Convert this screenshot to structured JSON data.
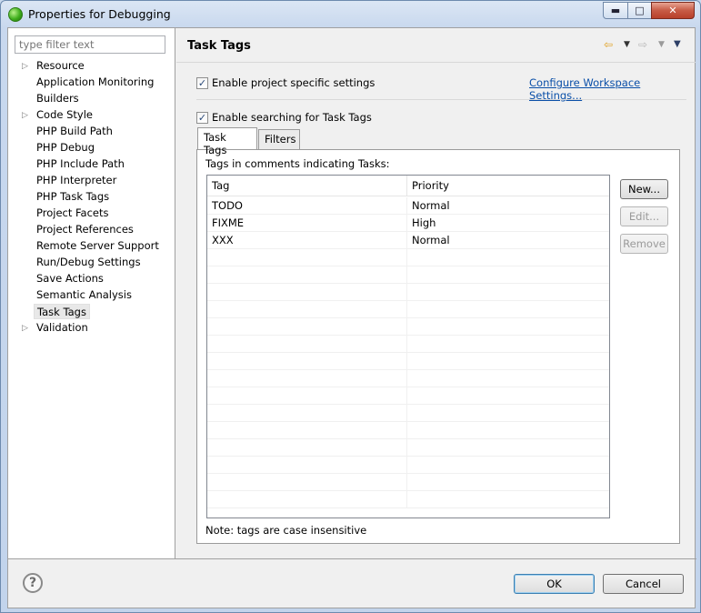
{
  "window": {
    "title": "Properties for Debugging"
  },
  "filter": {
    "placeholder": "type filter text"
  },
  "tree": [
    {
      "label": "Resource",
      "expandable": true
    },
    {
      "label": "Application Monitoring",
      "expandable": false
    },
    {
      "label": "Builders",
      "expandable": false
    },
    {
      "label": "Code Style",
      "expandable": true
    },
    {
      "label": "PHP Build Path",
      "expandable": false
    },
    {
      "label": "PHP Debug",
      "expandable": false
    },
    {
      "label": "PHP Include Path",
      "expandable": false
    },
    {
      "label": "PHP Interpreter",
      "expandable": false
    },
    {
      "label": "PHP Task Tags",
      "expandable": false
    },
    {
      "label": "Project Facets",
      "expandable": false
    },
    {
      "label": "Project References",
      "expandable": false
    },
    {
      "label": "Remote Server Support",
      "expandable": false
    },
    {
      "label": "Run/Debug Settings",
      "expandable": false
    },
    {
      "label": "Save Actions",
      "expandable": false
    },
    {
      "label": "Semantic Analysis",
      "expandable": false
    },
    {
      "label": "Task Tags",
      "expandable": false,
      "selected": true
    },
    {
      "label": "Validation",
      "expandable": true
    }
  ],
  "page": {
    "title": "Task Tags",
    "enable_project_specific": "Enable project specific settings",
    "configure_link": "Configure Workspace Settings...",
    "enable_search": "Enable searching for Task Tags",
    "tabs": [
      "Task Tags",
      "Filters"
    ],
    "panel_label": "Tags in comments indicating Tasks:",
    "columns": [
      "Tag",
      "Priority"
    ],
    "rows": [
      {
        "tag": "TODO",
        "priority": "Normal"
      },
      {
        "tag": "FIXME",
        "priority": "High"
      },
      {
        "tag": "XXX",
        "priority": "Normal"
      }
    ],
    "side_buttons": {
      "new": "New...",
      "edit": "Edit...",
      "remove": "Remove"
    },
    "note": "Note: tags are case insensitive"
  },
  "footer": {
    "ok": "OK",
    "cancel": "Cancel"
  },
  "colors": {
    "link": "#0a4fa8",
    "title_bar": "#c8d8ee",
    "close_button": "#c75b45"
  }
}
